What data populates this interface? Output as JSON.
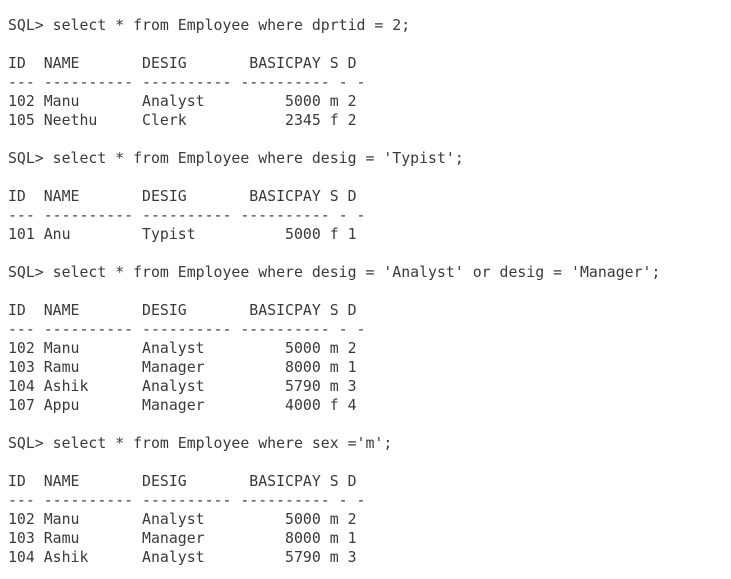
{
  "console": {
    "lines": [
      "SQL> select * from Employee where dprtid = 2;",
      "",
      "ID  NAME       DESIG       BASICPAY S D",
      "--- ---------- ---------- ---------- - -",
      "102 Manu       Analyst         5000 m 2",
      "105 Neethu     Clerk           2345 f 2",
      "",
      "SQL> select * from Employee where desig = 'Typist';",
      "",
      "ID  NAME       DESIG       BASICPAY S D",
      "--- ---------- ---------- ---------- - -",
      "101 Anu        Typist          5000 f 1",
      "",
      "SQL> select * from Employee where desig = 'Analyst' or desig = 'Manager';",
      "",
      "ID  NAME       DESIG       BASICPAY S D",
      "--- ---------- ---------- ---------- - -",
      "102 Manu       Analyst         5000 m 2",
      "103 Ramu       Manager         8000 m 1",
      "104 Ashik      Analyst         5790 m 3",
      "107 Appu       Manager         4000 f 4",
      "",
      "SQL> select * from Employee where sex ='m';",
      "",
      "ID  NAME       DESIG       BASICPAY S D",
      "--- ---------- ---------- ---------- - -",
      "102 Manu       Analyst         5000 m 2",
      "103 Ramu       Manager         8000 m 1",
      "104 Ashik      Analyst         5790 m 3"
    ]
  }
}
